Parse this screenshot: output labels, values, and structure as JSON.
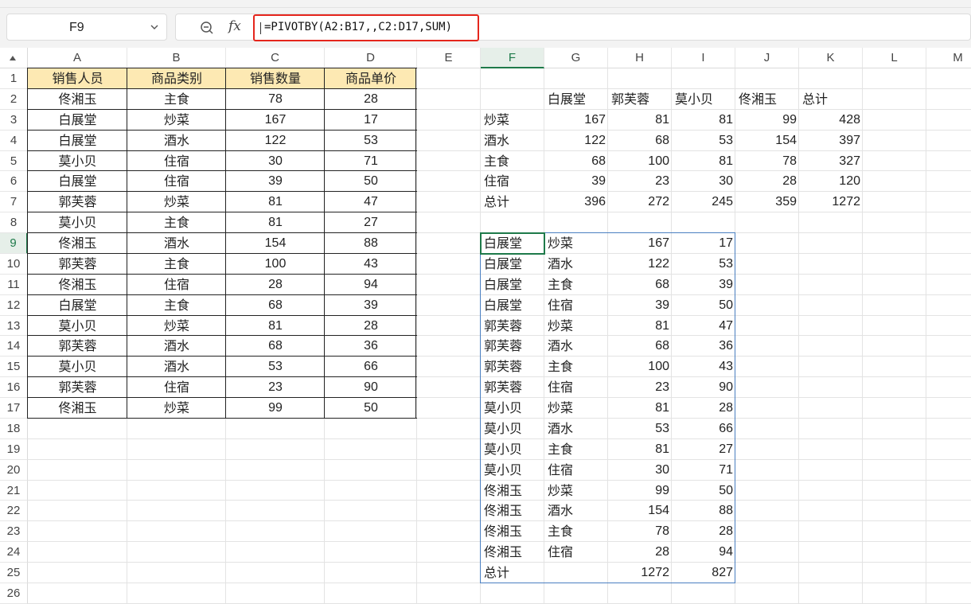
{
  "name_box": {
    "value": "F9"
  },
  "formula": {
    "fx_label": "fx",
    "text": "=PIVOTBY(A2:B17,,C2:D17,SUM)"
  },
  "columns": [
    "A",
    "B",
    "C",
    "D",
    "E",
    "F",
    "G",
    "H",
    "I",
    "J",
    "K",
    "L",
    "M"
  ],
  "rows": [
    "1",
    "2",
    "3",
    "4",
    "5",
    "6",
    "7",
    "8",
    "9",
    "10",
    "11",
    "12",
    "13",
    "14",
    "15",
    "16",
    "17",
    "18",
    "19",
    "20",
    "21",
    "22",
    "23",
    "24",
    "25",
    "26"
  ],
  "selected": {
    "column": "F",
    "row": "9"
  },
  "source_table": {
    "headers": [
      "销售人员",
      "商品类别",
      "销售数量",
      "商品单价"
    ],
    "rows": [
      [
        "佟湘玉",
        "主食",
        "78",
        "28"
      ],
      [
        "白展堂",
        "炒菜",
        "167",
        "17"
      ],
      [
        "白展堂",
        "酒水",
        "122",
        "53"
      ],
      [
        "莫小贝",
        "住宿",
        "30",
        "71"
      ],
      [
        "白展堂",
        "住宿",
        "39",
        "50"
      ],
      [
        "郭芙蓉",
        "炒菜",
        "81",
        "47"
      ],
      [
        "莫小贝",
        "主食",
        "81",
        "27"
      ],
      [
        "佟湘玉",
        "酒水",
        "154",
        "88"
      ],
      [
        "郭芙蓉",
        "主食",
        "100",
        "43"
      ],
      [
        "佟湘玉",
        "住宿",
        "28",
        "94"
      ],
      [
        "白展堂",
        "主食",
        "68",
        "39"
      ],
      [
        "莫小贝",
        "炒菜",
        "81",
        "28"
      ],
      [
        "郭芙蓉",
        "酒水",
        "68",
        "36"
      ],
      [
        "莫小贝",
        "酒水",
        "53",
        "66"
      ],
      [
        "郭芙蓉",
        "住宿",
        "23",
        "90"
      ],
      [
        "佟湘玉",
        "炒菜",
        "99",
        "50"
      ]
    ]
  },
  "pivot_cross": {
    "col_headers": [
      "白展堂",
      "郭芙蓉",
      "莫小贝",
      "佟湘玉",
      "总计"
    ],
    "rows": [
      [
        "炒菜",
        "167",
        "81",
        "81",
        "99",
        "428"
      ],
      [
        "酒水",
        "122",
        "68",
        "53",
        "154",
        "397"
      ],
      [
        "主食",
        "68",
        "100",
        "81",
        "78",
        "327"
      ],
      [
        "住宿",
        "39",
        "23",
        "30",
        "28",
        "120"
      ],
      [
        "总计",
        "396",
        "272",
        "245",
        "359",
        "1272"
      ]
    ]
  },
  "pivot_list": {
    "rows": [
      [
        "白展堂",
        "炒菜",
        "167",
        "17"
      ],
      [
        "白展堂",
        "酒水",
        "122",
        "53"
      ],
      [
        "白展堂",
        "主食",
        "68",
        "39"
      ],
      [
        "白展堂",
        "住宿",
        "39",
        "50"
      ],
      [
        "郭芙蓉",
        "炒菜",
        "81",
        "47"
      ],
      [
        "郭芙蓉",
        "酒水",
        "68",
        "36"
      ],
      [
        "郭芙蓉",
        "主食",
        "100",
        "43"
      ],
      [
        "郭芙蓉",
        "住宿",
        "23",
        "90"
      ],
      [
        "莫小贝",
        "炒菜",
        "81",
        "28"
      ],
      [
        "莫小贝",
        "酒水",
        "53",
        "66"
      ],
      [
        "莫小贝",
        "主食",
        "81",
        "27"
      ],
      [
        "莫小贝",
        "住宿",
        "30",
        "71"
      ],
      [
        "佟湘玉",
        "炒菜",
        "99",
        "50"
      ],
      [
        "佟湘玉",
        "酒水",
        "154",
        "88"
      ],
      [
        "佟湘玉",
        "主食",
        "78",
        "28"
      ],
      [
        "佟湘玉",
        "住宿",
        "28",
        "94"
      ],
      [
        "总计",
        "",
        "1272",
        "827"
      ]
    ]
  },
  "colors": {
    "header_fill": "#fde9b3",
    "selection": "#1e7a4a",
    "spill_border": "#4a7fc1",
    "formula_highlight": "#e5261d"
  }
}
